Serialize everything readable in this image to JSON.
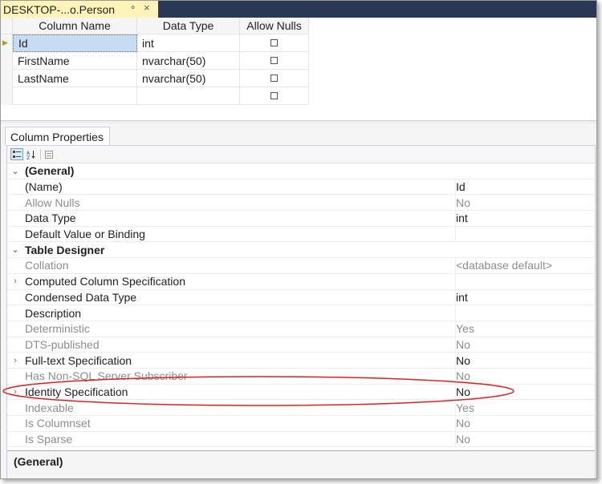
{
  "document_tab": {
    "title": "DESKTOP-...o.Person",
    "pin_icon": "pin-icon",
    "close_icon": "close-icon"
  },
  "grid": {
    "headers": [
      "Column Name",
      "Data Type",
      "Allow Nulls"
    ],
    "rows": [
      {
        "name": "Id",
        "type": "int",
        "allow_nulls": false,
        "current": true
      },
      {
        "name": "FirstName",
        "type": "nvarchar(50)",
        "allow_nulls": false
      },
      {
        "name": "LastName",
        "type": "nvarchar(50)",
        "allow_nulls": false
      },
      {
        "name": "",
        "type": "",
        "allow_nulls": false
      }
    ]
  },
  "column_properties": {
    "tab_label": "Column Properties",
    "toolbar": [
      "categorized-icon",
      "alphabetical-icon",
      "property-pages-icon"
    ],
    "rows": [
      {
        "kind": "category",
        "label": "(General)",
        "expander": "⌄"
      },
      {
        "kind": "prop",
        "label": "(Name)",
        "value": "Id"
      },
      {
        "kind": "prop",
        "label": "Allow Nulls",
        "value": "No",
        "dim": true
      },
      {
        "kind": "prop",
        "label": "Data Type",
        "value": "int"
      },
      {
        "kind": "prop",
        "label": "Default Value or Binding",
        "value": ""
      },
      {
        "kind": "category",
        "label": "Table Designer",
        "expander": "⌄"
      },
      {
        "kind": "prop",
        "label": "Collation",
        "value": "<database default>",
        "dim": true
      },
      {
        "kind": "prop",
        "label": "Computed Column Specification",
        "value": "",
        "expander": "›"
      },
      {
        "kind": "prop",
        "label": "Condensed Data Type",
        "value": "int"
      },
      {
        "kind": "prop",
        "label": "Description",
        "value": ""
      },
      {
        "kind": "prop",
        "label": "Deterministic",
        "value": "Yes",
        "dim": true
      },
      {
        "kind": "prop",
        "label": "DTS-published",
        "value": "No",
        "dim": true
      },
      {
        "kind": "prop",
        "label": "Full-text Specification",
        "value": "No",
        "expander": "›"
      },
      {
        "kind": "prop",
        "label": "Has Non-SQL Server Subscriber",
        "value": "No",
        "dim": true
      },
      {
        "kind": "prop",
        "label": "Identity Specification",
        "value": "No",
        "expander": "›"
      },
      {
        "kind": "prop",
        "label": "Indexable",
        "value": "Yes",
        "dim": true
      },
      {
        "kind": "prop",
        "label": "Is Columnset",
        "value": "No",
        "dim": true
      },
      {
        "kind": "prop",
        "label": "Is Sparse",
        "value": "No",
        "dim": true
      }
    ],
    "description_title": "(General)"
  },
  "annotation": {
    "color": "#e02020",
    "target": "Identity Specification"
  }
}
